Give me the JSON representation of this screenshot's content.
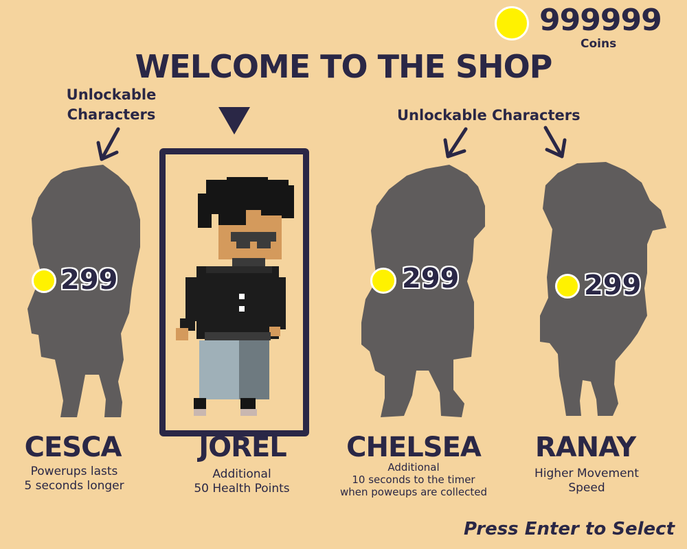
{
  "wallet": {
    "coins": "999999",
    "label": "Coins",
    "icon": "coin-icon"
  },
  "title": "WELCOME TO THE SHOP",
  "annotations": {
    "left": "Unlockable\nCharacters",
    "right": "Unlockable Characters"
  },
  "characters": [
    {
      "name": "CESCA",
      "desc": "Powerups lasts\n5 seconds longer",
      "price": "299",
      "locked": true
    },
    {
      "name": "JOREL",
      "desc": "Additional\n50 Health Points",
      "price": "",
      "locked": false,
      "selected": true
    },
    {
      "name": "CHELSEA",
      "desc": "Additional\n10 seconds to the timer\nwhen poweups are collected",
      "price": "299",
      "locked": true
    },
    {
      "name": "RANAY",
      "desc": "Higher Movement\nSpeed",
      "price": "299",
      "locked": true
    }
  ],
  "footer": {
    "hint": "Press Enter to Select"
  },
  "colors": {
    "background": "#f5d49e",
    "text": "#2a2746",
    "coin": "#fff200",
    "silhouette": "#5f5c5c"
  }
}
